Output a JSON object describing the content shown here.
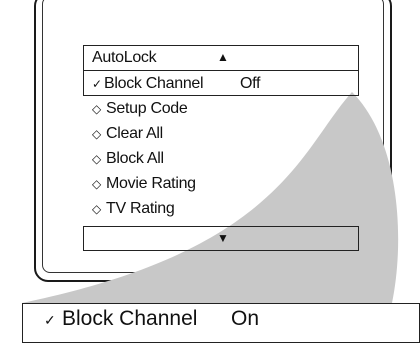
{
  "menu": {
    "header_label": "AutoLock",
    "header_arrow": "▲",
    "selected": {
      "check": "✓",
      "label": "Block Channel",
      "value": "Off"
    },
    "items": [
      {
        "marker": "◇",
        "label": "Setup Code"
      },
      {
        "marker": "◇",
        "label": "Clear All"
      },
      {
        "marker": "◇",
        "label": "Block All"
      },
      {
        "marker": "◇",
        "label": "Movie Rating"
      },
      {
        "marker": "◇",
        "label": "TV Rating"
      }
    ],
    "footer_arrow": "▼"
  },
  "zoom": {
    "check": "✓",
    "label": "Block Channel",
    "value": "On"
  },
  "colors": {
    "callout": "#c8c8c8",
    "frame": "#1a1a1a"
  }
}
